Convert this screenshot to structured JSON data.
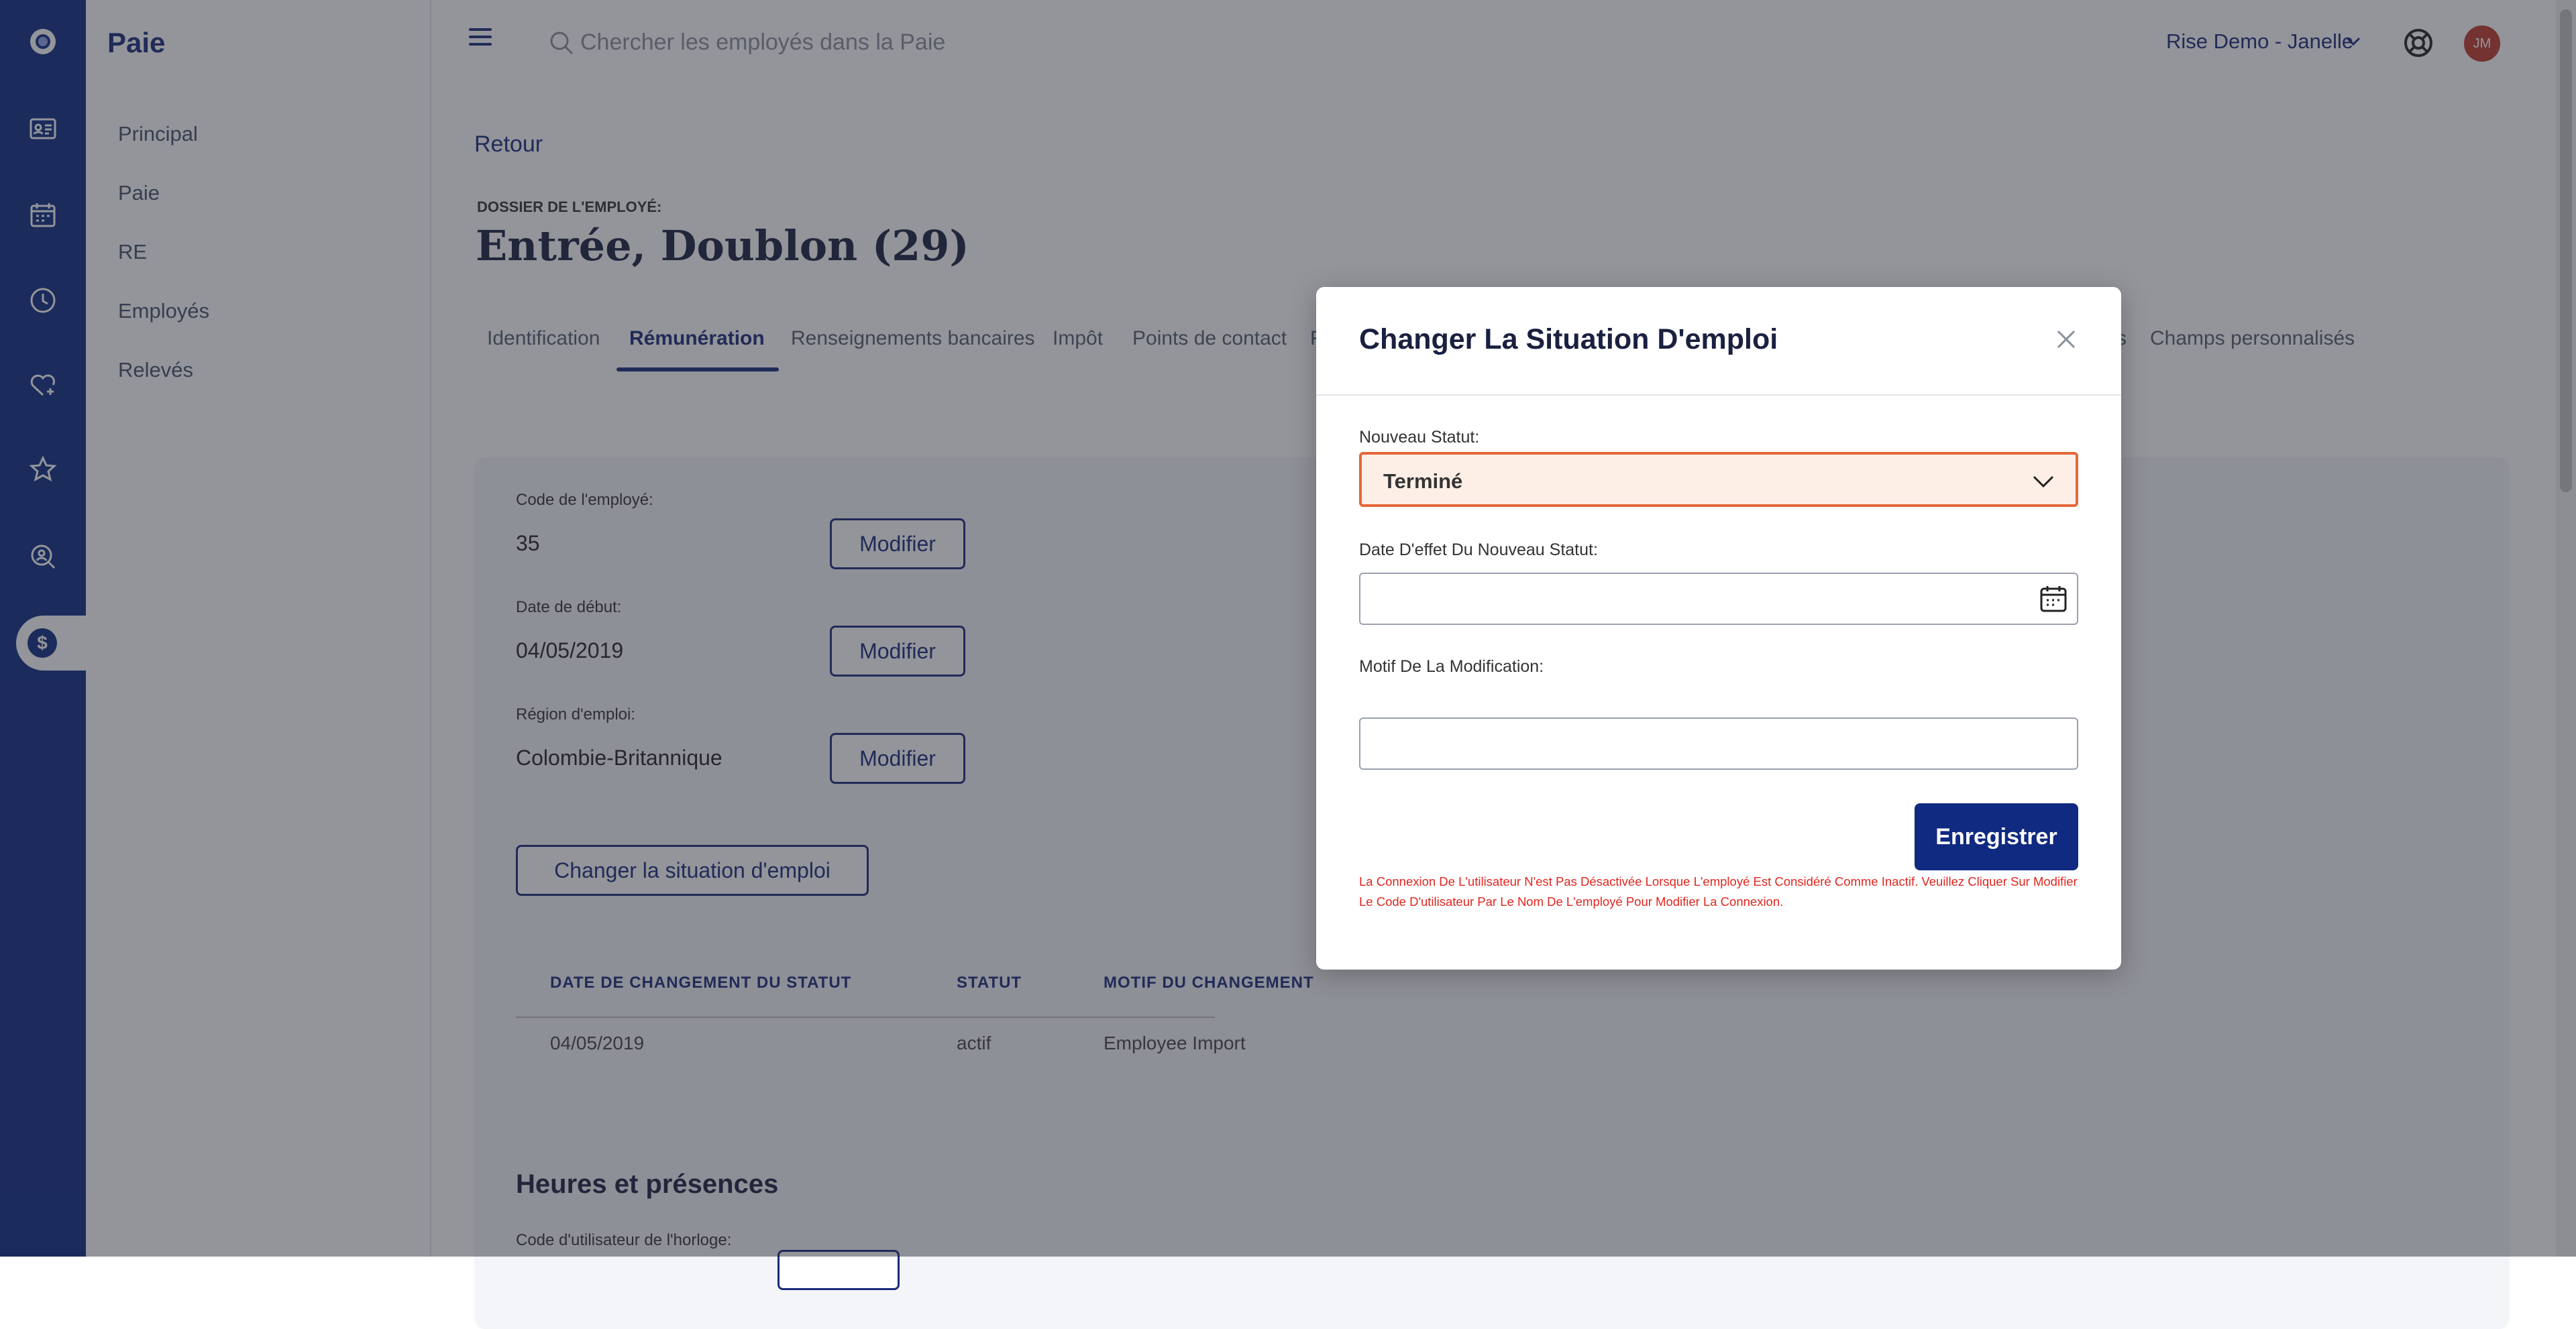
{
  "sidebar": {
    "title": "Paie",
    "items": [
      {
        "label": "Principal"
      },
      {
        "label": "Paie"
      },
      {
        "label": "RE"
      },
      {
        "label": "Employés"
      },
      {
        "label": "Relevés"
      }
    ]
  },
  "rail": {
    "icons": [
      "logo-icon",
      "id-card-icon",
      "calendar-icon",
      "clock-icon",
      "heart-plus-icon",
      "star-icon",
      "search-person-icon",
      "payroll-dollar-icon"
    ],
    "active": "payroll-dollar-icon"
  },
  "topbar": {
    "search_placeholder": "Chercher les employés dans la Paie",
    "company": "Rise Demo - Janelle",
    "avatar_initials": "JM"
  },
  "page": {
    "back": "Retour",
    "record_label": "DOSSIER DE L'EMPLOYÉ:",
    "record_name": "Entrée, Doublon (29)"
  },
  "tabs": [
    {
      "label": "Identification"
    },
    {
      "label": "Rémunération",
      "active": true
    },
    {
      "label": "Renseignements bancaires"
    },
    {
      "label": "Impôt"
    },
    {
      "label": "Points de contact"
    },
    {
      "label": "F"
    },
    {
      "label": "s"
    },
    {
      "label": "Champs personnalisés"
    }
  ],
  "card": {
    "employee_code_label": "Code de l'employé:",
    "employee_code": "35",
    "start_date_label": "Date de début:",
    "start_date": "04/05/2019",
    "region_label": "Région d'emploi:",
    "region": "Colombie-Britannique",
    "modify": "Modifier",
    "change_status": "Changer la situation d'emploi",
    "table": {
      "headers": [
        "DATE DE CHANGEMENT DU STATUT",
        "STATUT",
        "MOTIF DU CHANGEMENT"
      ],
      "rows": [
        [
          "04/05/2019",
          "actif",
          "Employee Import"
        ]
      ]
    },
    "hours_title": "Heures et présences",
    "clock_code_label": "Code d'utilisateur de l'horloge:"
  },
  "modal": {
    "title": "Changer La Situation D'emploi",
    "new_status_label": "Nouveau Statut:",
    "new_status_value": "Terminé",
    "effective_date_label": "Date D'effet Du Nouveau Statut:",
    "reason_label": "Motif De La Modification:",
    "save": "Enregistrer",
    "warning": "La Connexion De L'utilisateur N'est Pas Désactivée Lorsque L'employé Est Considéré Comme Inactif. Veuillez Cliquer Sur Modifier Le Code D'utilisateur Par Le Nom De L'employé Pour Modifier La Connexion."
  },
  "colors": {
    "brand": "#0f2a80",
    "select_highlight": "#e5673a",
    "warning": "#e0261f",
    "avatar": "#c0392b"
  }
}
